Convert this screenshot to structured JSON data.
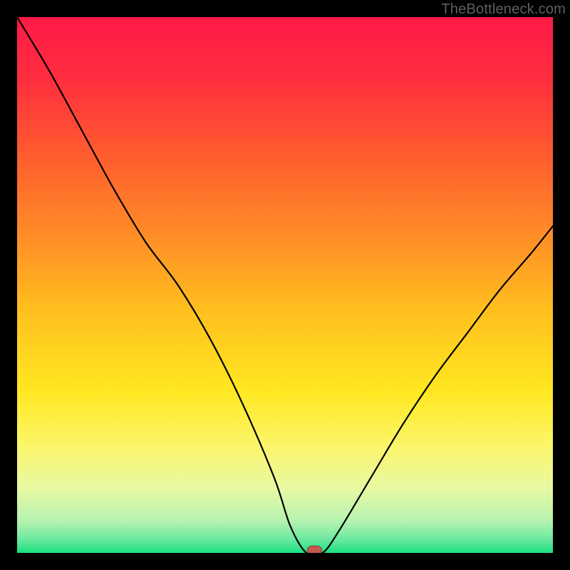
{
  "attribution": "TheBottleneck.com",
  "chart_data": {
    "type": "line",
    "title": "",
    "xlabel": "",
    "ylabel": "",
    "xlim": [
      0,
      100
    ],
    "ylim": [
      0,
      100
    ],
    "grid": false,
    "legend": false,
    "annotations": [],
    "series": [
      {
        "name": "curve",
        "x": [
          0,
          6,
          12,
          18,
          24,
          30,
          36,
          42,
          48,
          51,
          54,
          57,
          60,
          66,
          72,
          78,
          84,
          90,
          96,
          100
        ],
        "y": [
          100,
          90,
          79,
          68,
          58,
          50,
          40,
          28,
          14,
          5,
          0,
          0,
          4,
          14,
          24,
          33,
          41,
          49,
          56,
          61
        ]
      }
    ],
    "marker": {
      "x": 55.5,
      "y": 0.5
    },
    "gradient_stops": [
      {
        "offset": 0.0,
        "color": "#ff1a47"
      },
      {
        "offset": 0.12,
        "color": "#ff2f3e"
      },
      {
        "offset": 0.25,
        "color": "#ff5a2f"
      },
      {
        "offset": 0.4,
        "color": "#ff8a27"
      },
      {
        "offset": 0.55,
        "color": "#ffc01e"
      },
      {
        "offset": 0.7,
        "color": "#ffe821"
      },
      {
        "offset": 0.8,
        "color": "#fbf66a"
      },
      {
        "offset": 0.88,
        "color": "#e8f8a3"
      },
      {
        "offset": 0.94,
        "color": "#b6f3b0"
      },
      {
        "offset": 0.975,
        "color": "#6be8a0"
      },
      {
        "offset": 1.0,
        "color": "#18e07f"
      }
    ],
    "colors": {
      "line": "#000000",
      "marker_fill": "#c5584f",
      "marker_stroke": "#8a3a33",
      "frame": "#000000"
    }
  }
}
